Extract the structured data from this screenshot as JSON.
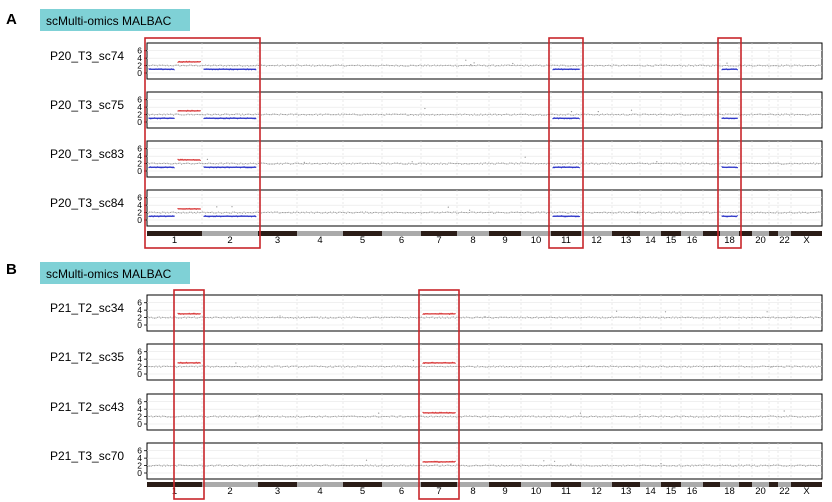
{
  "panels": [
    {
      "letter": "A",
      "header": "scMulti-omics MALBAC"
    },
    {
      "letter": "B",
      "header": "scMulti-omics MALBAC"
    }
  ],
  "colors": {
    "header_bg": "#7fd1d6",
    "normal": "#8c8c8c",
    "loss": "#2c34c8",
    "gain": "#d93a3a",
    "highlight": "#c8262b",
    "chr_dark": "#2b1d17",
    "chr_light": "#aaaaaa"
  },
  "chart_data": [
    {
      "type": "scatter",
      "panel": "A",
      "y_ticks": [
        0,
        2,
        4,
        6
      ],
      "ylim": [
        0,
        7
      ],
      "x_tick_labels": [
        "1",
        "2",
        "3",
        "4",
        "5",
        "6",
        "7",
        "8",
        "9",
        "10",
        "11",
        "12",
        "13",
        "14",
        "15",
        "16",
        "18",
        "20",
        "22",
        "X"
      ],
      "highlighted_chromosomes": [
        "1-2",
        "11",
        "18"
      ],
      "series": [
        {
          "name": "P20_T3_sc74",
          "baseline": 2,
          "segments": [
            {
              "chromosome": "1p",
              "copy_number": 1
            },
            {
              "chromosome": "1q",
              "copy_number": 3
            },
            {
              "chromosome": "2",
              "copy_number": 1
            },
            {
              "chromosome": "11",
              "copy_number": 1
            },
            {
              "chromosome": "18",
              "copy_number": 1
            }
          ]
        },
        {
          "name": "P20_T3_sc75",
          "baseline": 2,
          "segments": [
            {
              "chromosome": "1p",
              "copy_number": 1
            },
            {
              "chromosome": "1q",
              "copy_number": 3
            },
            {
              "chromosome": "2",
              "copy_number": 1
            },
            {
              "chromosome": "11",
              "copy_number": 1
            },
            {
              "chromosome": "18",
              "copy_number": 1
            }
          ]
        },
        {
          "name": "P20_T3_sc83",
          "baseline": 2,
          "segments": [
            {
              "chromosome": "1p",
              "copy_number": 1
            },
            {
              "chromosome": "1q",
              "copy_number": 3
            },
            {
              "chromosome": "2",
              "copy_number": 1
            },
            {
              "chromosome": "11",
              "copy_number": 1
            },
            {
              "chromosome": "18",
              "copy_number": 1
            }
          ]
        },
        {
          "name": "P20_T3_sc84",
          "baseline": 2,
          "segments": [
            {
              "chromosome": "1p",
              "copy_number": 1
            },
            {
              "chromosome": "1q",
              "copy_number": 3
            },
            {
              "chromosome": "2",
              "copy_number": 1
            },
            {
              "chromosome": "11",
              "copy_number": 1
            },
            {
              "chromosome": "18",
              "copy_number": 1
            }
          ]
        }
      ]
    },
    {
      "type": "scatter",
      "panel": "B",
      "y_ticks": [
        0,
        2,
        4,
        6
      ],
      "ylim": [
        0,
        7
      ],
      "x_tick_labels": [
        "1",
        "2",
        "3",
        "4",
        "5",
        "6",
        "7",
        "8",
        "9",
        "10",
        "11",
        "12",
        "13",
        "14",
        "15",
        "16",
        "18",
        "20",
        "22",
        "X"
      ],
      "highlighted_chromosomes": [
        "1q",
        "7"
      ],
      "series": [
        {
          "name": "P21_T2_sc34",
          "baseline": 2,
          "segments": [
            {
              "chromosome": "1q",
              "copy_number": 3
            },
            {
              "chromosome": "7",
              "copy_number": 3
            }
          ]
        },
        {
          "name": "P21_T2_sc35",
          "baseline": 2,
          "segments": [
            {
              "chromosome": "1q",
              "copy_number": 3
            },
            {
              "chromosome": "7",
              "copy_number": 3
            }
          ]
        },
        {
          "name": "P21_T2_sc43",
          "baseline": 2,
          "segments": [
            {
              "chromosome": "7",
              "copy_number": 3
            }
          ]
        },
        {
          "name": "P21_T3_sc70",
          "baseline": 2,
          "segments": [
            {
              "chromosome": "7",
              "copy_number": 3
            }
          ]
        }
      ]
    }
  ]
}
